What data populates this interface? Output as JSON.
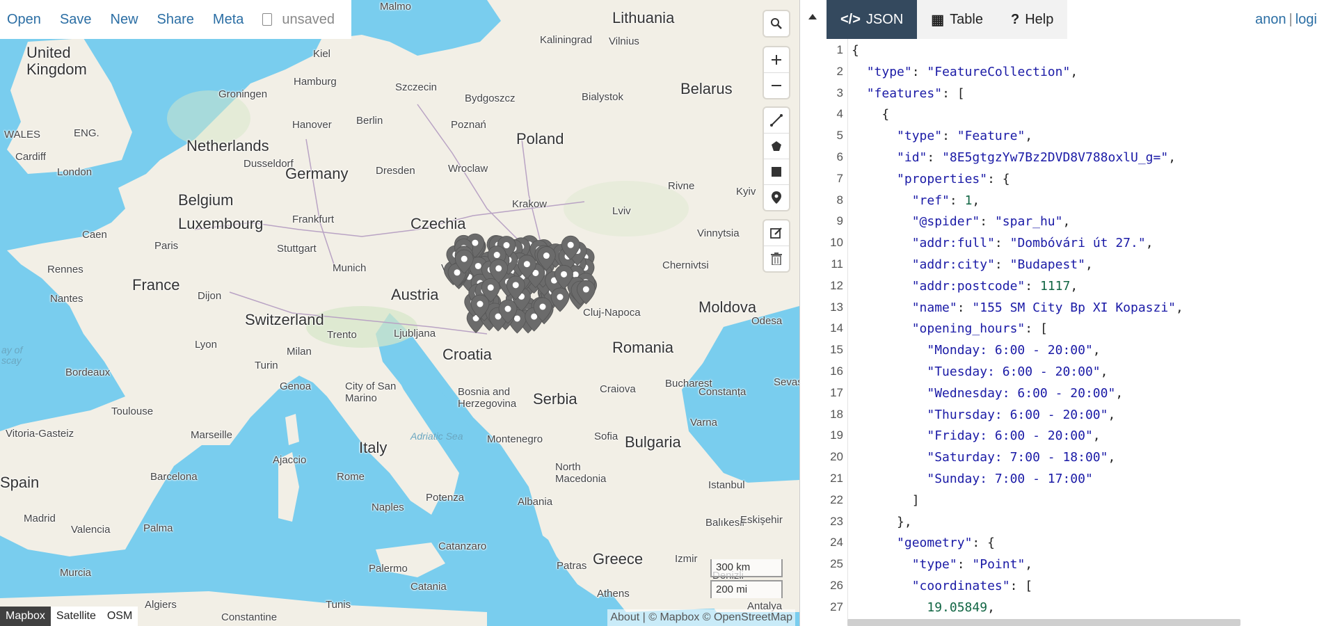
{
  "menu": {
    "items": [
      "Open",
      "Save",
      "New",
      "Share",
      "Meta"
    ],
    "file_status": "unsaved"
  },
  "map": {
    "labels": {
      "lithuania": "Lithuania",
      "malmo": "Malmo",
      "kaliningrad": "Kaliningrad",
      "vilnius": "Vilnius",
      "uk": "United\nKingdom",
      "kiel": "Kiel",
      "hamburg": "Hamburg",
      "szczecin": "Szczecin",
      "belarus": "Belarus",
      "groningen": "Groningen",
      "bydgoszcz": "Bydgoszcz",
      "bialystok": "Bialystok",
      "wales": "WALES",
      "eng": "ENG.",
      "hanover": "Hanover",
      "berlin": "Berlin",
      "poznan": "Poznań",
      "poland": "Poland",
      "cardiff": "Cardiff",
      "netherlands": "Netherlands",
      "dusseldorf": "Dusseldorf",
      "london": "London",
      "germany": "Germany",
      "dresden": "Dresden",
      "wroclaw": "Wroclaw",
      "rivne": "Rivne",
      "kyiv": "Kyiv",
      "belgium": "Belgium",
      "krakow": "Krakow",
      "lviv": "Lviv",
      "luxembourg": "Luxembourg",
      "frankfurt": "Frankfurt",
      "czechia": "Czechia",
      "vinnytsia": "Vinnytsia",
      "caen": "Caen",
      "paris": "Paris",
      "stuttgart": "Stuttgart",
      "rennes": "Rennes",
      "munich": "Munich",
      "vienna": "Vienn",
      "chernivtsi": "Chernivtsi",
      "france": "France",
      "nantes": "Nantes",
      "dijon": "Dijon",
      "austria": "Austria",
      "moldova": "Moldova",
      "switzerland": "Switzerland",
      "clujnapoca": "Cluj-Napoca",
      "odesa": "Odesa",
      "lyon": "Lyon",
      "trento": "Trento",
      "ljubljana": "Ljubljana",
      "romania": "Romania",
      "bayof": "ay of\nscay",
      "milan": "Milan",
      "croatia": "Croatia",
      "bordeaux": "Bordeaux",
      "turin": "Turin",
      "bucharest": "Bucharest",
      "sevas": "Sevas",
      "genoa": "Genoa",
      "cityofsanmarino": "City of San\nMarino",
      "craiova": "Craiova",
      "constanta": "Constanța",
      "bosnia": "Bosnia and\nHerzegovina",
      "serbia": "Serbia",
      "toulouse": "Toulouse",
      "varna": "Varna",
      "adriatic": "Adriatic Sea",
      "vitoria": "Vitoria-Gasteiz",
      "marseille": "Marseille",
      "montenegro": "Montenegro",
      "sofia": "Sofia",
      "bulgaria": "Bulgaria",
      "italy": "Italy",
      "ajaccio": "Ajaccio",
      "north": "North\nMacedonia",
      "spain": "Spain",
      "barcelona": "Barcelona",
      "rome": "Rome",
      "istanbul": "Istanbul",
      "albania": "Albania",
      "naples": "Naples",
      "potenza": "Potenza",
      "madrid": "Madrid",
      "valencia": "Valencia",
      "palma": "Palma",
      "balikesir": "Balıkesir",
      "eskisehir": "Eskişehir",
      "catanzaro": "Catanzaro",
      "greece": "Greece",
      "izmir": "Izmir",
      "palermo": "Palermo",
      "patras": "Patras",
      "denizli": "Denizli",
      "murcia": "Murcia",
      "catania": "Catania",
      "athens": "Athens",
      "algiers": "Algiers",
      "tunis": "Tunis",
      "constantine": "Constantine",
      "antalya": "Antalya"
    },
    "scale": [
      "300 km",
      "200 mi"
    ],
    "layers": [
      "Mapbox",
      "Satellite",
      "OSM"
    ],
    "active_layer": "Mapbox",
    "attribution": "About | © Mapbox © OpenStreetMap",
    "controls": [
      "search-icon",
      "zoom-in-icon",
      "zoom-out-icon",
      "draw-line-icon",
      "draw-polygon-icon",
      "draw-rectangle-icon",
      "draw-marker-icon",
      "edit-icon",
      "trash-icon"
    ],
    "marker_color": "#6b6b6b"
  },
  "panel": {
    "tabs": [
      {
        "icon": "</>",
        "label": "JSON",
        "active": true
      },
      {
        "icon": "▦",
        "label": "Table",
        "active": false
      },
      {
        "icon": "?",
        "label": "Help",
        "active": false
      }
    ],
    "user": "anon",
    "login": "logi",
    "accent": "#34495e"
  },
  "code": {
    "line_numbers": [
      "1",
      "2",
      "3",
      "4",
      "5",
      "6",
      "7",
      "8",
      "9",
      "10",
      "11",
      "12",
      "13",
      "14",
      "15",
      "16",
      "17",
      "18",
      "19",
      "20",
      "21",
      "22",
      "23",
      "24",
      "25",
      "26",
      "27"
    ],
    "lines": [
      "{",
      "  \"type\": \"FeatureCollection\",",
      "  \"features\": [",
      "    {",
      "      \"type\": \"Feature\",",
      "      \"id\": \"8E5gtgzYw7Bz2DVD8V788oxlU_g=\",",
      "      \"properties\": {",
      "        \"ref\": 1,",
      "        \"@spider\": \"spar_hu\",",
      "        \"addr:full\": \"Dombóvári út 27.\",",
      "        \"addr:city\": \"Budapest\",",
      "        \"addr:postcode\": 1117,",
      "        \"name\": \"155 SM City Bp XI Kopaszi\",",
      "        \"opening_hours\": [",
      "          \"Monday: 6:00 - 20:00\",",
      "          \"Tuesday: 6:00 - 20:00\",",
      "          \"Wednesday: 6:00 - 20:00\",",
      "          \"Thursday: 6:00 - 20:00\",",
      "          \"Friday: 6:00 - 20:00\",",
      "          \"Saturday: 7:00 - 18:00\",",
      "          \"Sunday: 7:00 - 17:00\"",
      "        ]",
      "      },",
      "      \"geometry\": {",
      "        \"type\": \"Point\",",
      "        \"coordinates\": [",
      "          19.05849,"
    ]
  }
}
